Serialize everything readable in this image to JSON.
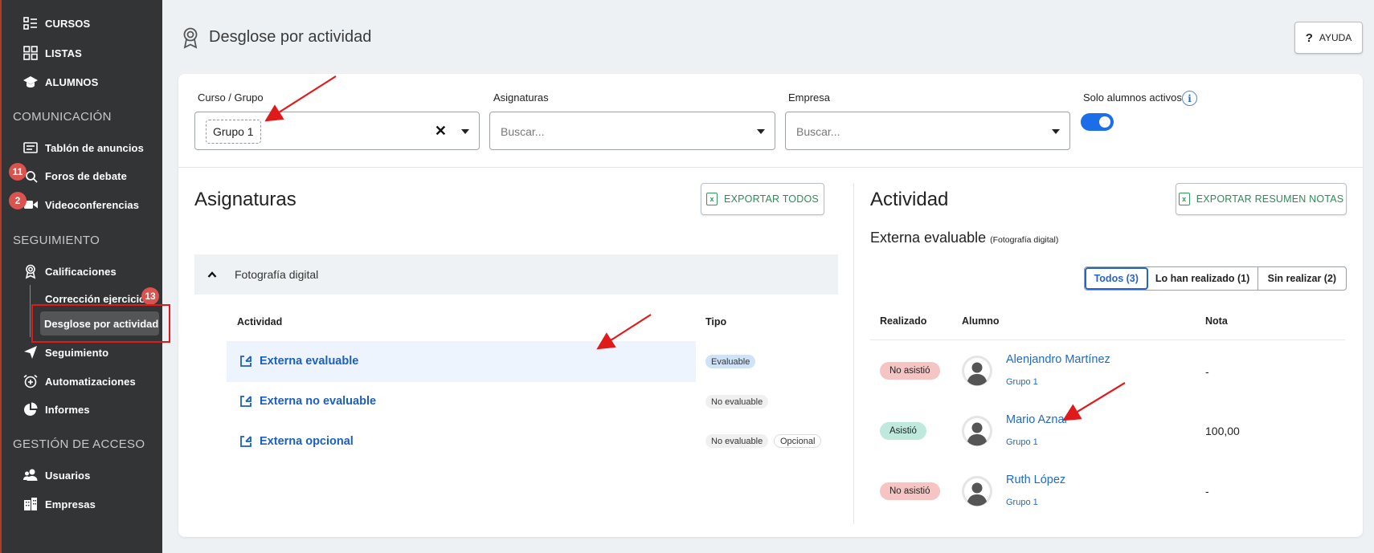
{
  "sidebar": {
    "items_top": [
      {
        "label": "CURSOS",
        "icon": "list-icon"
      },
      {
        "label": "LISTAS",
        "icon": "grid-icon"
      },
      {
        "label": "ALUMNOS",
        "icon": "graduation-cap-icon"
      }
    ],
    "sections": {
      "comunicacion": "COMUNICACIÓN",
      "seguimiento": "SEGUIMIENTO",
      "acceso": "GESTIÓN DE ACCESO"
    },
    "comunicacion_items": [
      {
        "label": "Tablón de anuncios"
      },
      {
        "label": "Foros de debate",
        "badge": "11"
      },
      {
        "label": "Videoconferencias",
        "badge": "2"
      }
    ],
    "seguimiento_items": [
      {
        "label": "Calificaciones"
      },
      {
        "label": "Seguimiento"
      },
      {
        "label": "Automatizaciones"
      },
      {
        "label": "Informes"
      }
    ],
    "sub_items": [
      {
        "label": "Corrección ejercicios",
        "badge": "13"
      },
      {
        "label": "Desglose por actividad"
      }
    ],
    "acceso_items": [
      {
        "label": "Usuarios"
      },
      {
        "label": "Empresas"
      }
    ]
  },
  "header": {
    "title": "Desglose por actividad",
    "help_label": "AYUDA"
  },
  "filters": {
    "curso_label": "Curso / Grupo",
    "curso_value": "Grupo 1",
    "asignaturas_label": "Asignaturas",
    "asignaturas_placeholder": "Buscar...",
    "empresa_label": "Empresa",
    "empresa_placeholder": "Buscar...",
    "solo_activos_label": "Solo alumnos activos",
    "solo_activos_on": true
  },
  "asignaturas": {
    "title": "Asignaturas",
    "export_label": "EXPORTAR TODOS",
    "accordion_label": "Fotografía digital",
    "columns": [
      "Actividad",
      "Tipo"
    ],
    "rows": [
      {
        "name": "Externa evaluable",
        "tags": [
          "Evaluable"
        ]
      },
      {
        "name": "Externa no evaluable",
        "tags": [
          "No evaluable"
        ]
      },
      {
        "name": "Externa opcional",
        "tags": [
          "No evaluable",
          "Opcional"
        ]
      }
    ]
  },
  "actividad": {
    "title": "Actividad",
    "export_label": "EXPORTAR RESUMEN NOTAS",
    "subtitle": "Externa evaluable",
    "subtitle_small": "(Fotografía digital)",
    "segments": [
      "Todos (3)",
      "Lo han realizado (1)",
      "Sin realizar (2)"
    ],
    "columns": [
      "Realizado",
      "Alumno",
      "Nota"
    ],
    "rows": [
      {
        "status": "No asistió",
        "name": "Alenjandro Martínez",
        "group": "Grupo 1",
        "grade": "-"
      },
      {
        "status": "Asistió",
        "name": "Mario Aznar",
        "group": "Grupo 1",
        "grade": "100,00"
      },
      {
        "status": "No asistió",
        "name": "Ruth López",
        "group": "Grupo 1",
        "grade": "-"
      }
    ]
  },
  "colors": {
    "sidebar": "#333436",
    "accent": "#1c6ee8",
    "link": "#1a5fc4",
    "export": "#2f8a5a",
    "badge": "#d9534f",
    "red_annotation": "#e01a1a",
    "status_no": "#f7c4c4",
    "status_yes": "#bfe9dc"
  }
}
